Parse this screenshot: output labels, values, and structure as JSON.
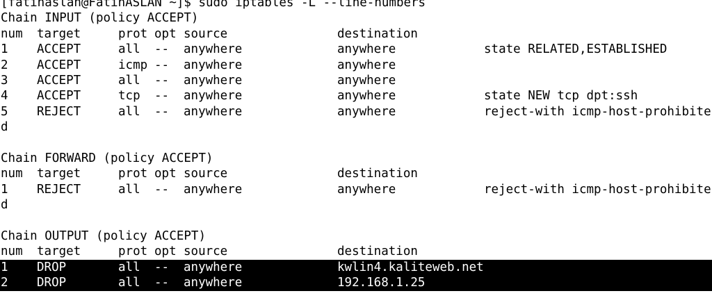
{
  "terminal": {
    "command_line": "[fatihaslan@FatihASLAN ~]$ sudo iptables -L --line-numbers",
    "chains": [
      {
        "title": "Chain INPUT (policy ACCEPT)",
        "headers": [
          "num",
          "target",
          "prot",
          "opt",
          "source",
          "destination",
          ""
        ],
        "rows": [
          [
            "1",
            "ACCEPT",
            "all",
            "--",
            "anywhere",
            "anywhere",
            "state RELATED,ESTABLISHED"
          ],
          [
            "2",
            "ACCEPT",
            "icmp",
            "--",
            "anywhere",
            "anywhere",
            ""
          ],
          [
            "3",
            "ACCEPT",
            "all",
            "--",
            "anywhere",
            "anywhere",
            ""
          ],
          [
            "4",
            "ACCEPT",
            "tcp",
            "--",
            "anywhere",
            "anywhere",
            "state NEW tcp dpt:ssh"
          ],
          [
            "5",
            "REJECT",
            "all",
            "--",
            "anywhere",
            "anywhere",
            "reject-with icmp-host-prohibite"
          ]
        ],
        "wrap": "d"
      },
      {
        "title": "Chain FORWARD (policy ACCEPT)",
        "headers": [
          "num",
          "target",
          "prot",
          "opt",
          "source",
          "destination",
          ""
        ],
        "rows": [
          [
            "1",
            "REJECT",
            "all",
            "--",
            "anywhere",
            "anywhere",
            "reject-with icmp-host-prohibite"
          ]
        ],
        "wrap": "d"
      },
      {
        "title": "Chain OUTPUT (policy ACCEPT)",
        "headers": [
          "num",
          "target",
          "prot",
          "opt",
          "source",
          "destination",
          ""
        ],
        "rows": [
          [
            "1",
            "DROP",
            "all",
            "--",
            "anywhere",
            "kwlin4.kaliteweb.net",
            ""
          ],
          [
            "2",
            "DROP",
            "all",
            "--",
            "anywhere",
            "192.168.1.25",
            ""
          ]
        ],
        "highlighted_rows": [
          0,
          1
        ]
      }
    ]
  }
}
